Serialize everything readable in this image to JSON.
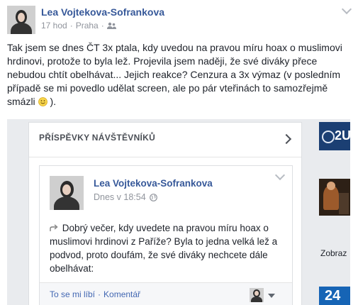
{
  "post": {
    "author": "Lea Vojtekova-Sofrankova",
    "time": "17 hod",
    "separator": "·",
    "location": "Praha",
    "separator2": "·",
    "text": "Tak jsem se dnes ČT 3x ptala, kdy uvedou na pravou míru hoax o muslimovi hrdinovi, protože to byla lež. Projevila jsem naději, že své diváky přece nebudou chtít obelhávat... Jejich reakce? Cenzura a 3x výmaz (v posledním případě se mi povedlo udělat screen, ale po pár vteřinách to samozřejmě smázli",
    "text_end": " )."
  },
  "screenshot": {
    "panel_title": "PŘÍSPĚVKY NÁVŠTĚVNÍKŮ",
    "comment": {
      "author": "Lea Vojtekova-Sofrankova",
      "time": "Dnes v 18:54",
      "text": "Dobrý večer, kdy uvedete na pravou míru hoax o muslimovi hrdinovi z Paříže? Byla to jedna velká lež a podvod, proto doufám, že své diváky nechcete dále obelhávat:",
      "like_label": "To se mi líbí",
      "dot": "·",
      "comment_label": "Komentář"
    },
    "right_column": {
      "badge_text": "2U",
      "caption": "Zobraz",
      "badge2_text": "24"
    }
  }
}
